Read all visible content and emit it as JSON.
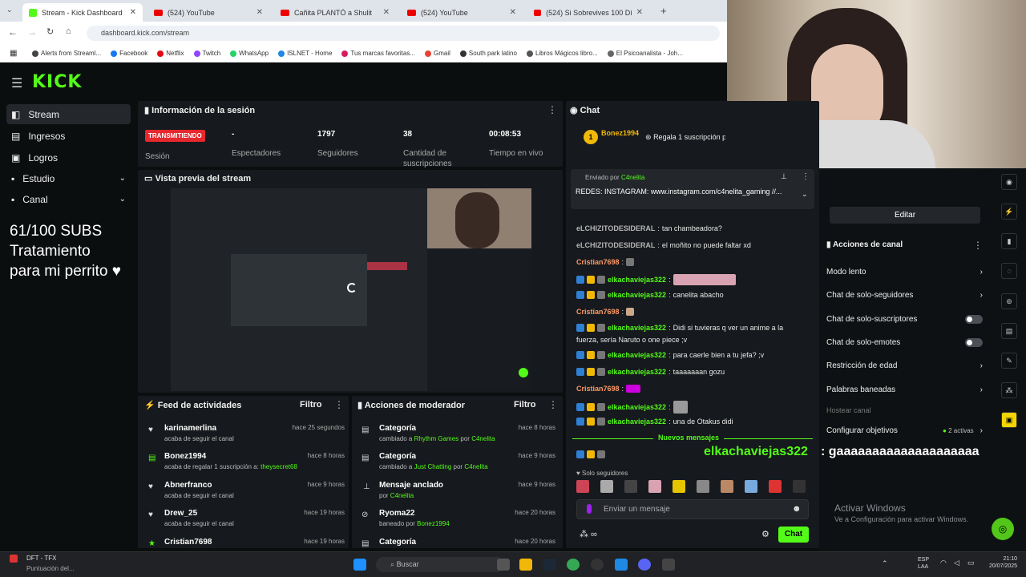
{
  "browser": {
    "tabs": [
      {
        "label": "Stream - Kick Dashboard"
      },
      {
        "label": "(524) YouTube"
      },
      {
        "label": "Cañita PLANTÓ a Shulit"
      },
      {
        "label": "(524) YouTube"
      },
      {
        "label": "(524) Si Sobrevives 100 Días At"
      }
    ],
    "url": "dashboard.kick.com/stream",
    "bookmarks": [
      "Alerts from Streaml...",
      "Facebook",
      "Netflix",
      "Twitch",
      "WhatsApp",
      "ISLNET - Home",
      "Tus marcas favoritas...",
      "Gmail",
      "South park latino",
      "Libros Mágicos libro...",
      "El Psicoanalista - Joh..."
    ]
  },
  "kick": {
    "logo": "KICK"
  },
  "sidebar": {
    "items": [
      {
        "label": "Stream"
      },
      {
        "label": "Ingresos"
      },
      {
        "label": "Logros"
      },
      {
        "label": "Estudio"
      },
      {
        "label": "Canal"
      }
    ]
  },
  "overlay": {
    "line1": "61/100 SUBS",
    "line2": "Tratamiento",
    "line3": "para mi perrito ♥"
  },
  "session": {
    "title": "Información de la sesión",
    "status": "TRANSMITIENDO",
    "status_label": "Sesión",
    "viewers": "-",
    "viewers_label": "Espectadores",
    "followers": "1797",
    "followers_label": "Seguidores",
    "subs": "38",
    "subs_label": "Cantidad de suscripciones",
    "uptime": "00:08:53",
    "uptime_label": "Tiempo en vivo"
  },
  "preview": {
    "title": "Vista previa del stream"
  },
  "activity": {
    "title": "Feed de actividades",
    "filter": "Filtro",
    "items": [
      {
        "name": "karinamerlina",
        "sub": "acaba de seguir el canal",
        "time": "hace 25 segundos"
      },
      {
        "name": "Bonez1994",
        "sub": "acaba de regalar 1 suscripción a:",
        "sub2": "theysecret68",
        "time": "hace 8 horas"
      },
      {
        "name": "Abnerfranco",
        "sub": "acaba de seguir el canal",
        "time": "hace 9 horas"
      },
      {
        "name": "Drew_25",
        "sub": "acaba de seguir el canal",
        "time": "hace 19 horas"
      },
      {
        "name": "Cristian7698",
        "sub": "",
        "time": "hace 19 horas"
      }
    ]
  },
  "modactions": {
    "title": "Acciones de moderador",
    "filter": "Filtro",
    "items": [
      {
        "name": "Categoría",
        "sub": "cambiado a",
        "hl": "Rhythm Games",
        "sub2": "por",
        "by": "C4nelita",
        "time": "hace 8 horas"
      },
      {
        "name": "Categoría",
        "sub": "cambiado a",
        "hl": "Just Chatting",
        "sub2": "por",
        "by": "C4nelita",
        "time": "hace 9 horas"
      },
      {
        "name": "Mensaje anclado",
        "sub": "por",
        "hl": "C4nelita",
        "sub2": "",
        "by": "",
        "time": "hace 9 horas"
      },
      {
        "name": "Ryoma22",
        "sub": "baneado por",
        "hl": "Bonez1994",
        "sub2": "",
        "by": "",
        "time": "hace 20 horas"
      },
      {
        "name": "Categoría",
        "sub": "",
        "hl": "",
        "sub2": "",
        "by": "",
        "time": "hace 20 horas"
      }
    ]
  },
  "chat": {
    "title": "Chat",
    "gift_user": "Bonez1994",
    "gift_count": "1",
    "gift_text": "Regala 1 suscripción p",
    "pinned_by_label": "Enviado por",
    "pinned_by": "C4nelita",
    "pinned_text": "REDES: INSTAGRAM: www.instagram.com/c4nelita_gaming //...",
    "messages": [
      {
        "user": "eLCHIZITODESIDERAL",
        "text": "tan chambeadora?"
      },
      {
        "user": "eLCHIZITODESIDERAL",
        "text": "el moñito no puede faltar xd"
      },
      {
        "user": "Cristian7698",
        "text": ""
      },
      {
        "user": "elkachaviejas322",
        "text": ""
      },
      {
        "user": "elkachaviejas322",
        "text": "canelita abacho"
      },
      {
        "user": "Cristian7698",
        "text": ""
      },
      {
        "user": "elkachaviejas322",
        "text": "Didi si tuvieras q ver un anime a la"
      },
      {
        "user": "",
        "text": "fuerza, sería Naruto o one piece ;v"
      },
      {
        "user": "elkachaviejas322",
        "text": "para caerle bien a tu jefa? ;v"
      },
      {
        "user": "elkachaviejas322",
        "text": "taaaaaaan gozu"
      },
      {
        "user": "Cristian7698",
        "text": ""
      },
      {
        "user": "elkachaviejas322",
        "text": ""
      },
      {
        "user": "elkachaviejas322",
        "text": "una de Otakus didi"
      }
    ],
    "new_messages": "Nuevos mensajes",
    "last_user": "elkachaviejas322",
    "big_msg": ": gaaaaaaaaaaaaaaaaaaaa",
    "followers_only": "Solo seguidores",
    "input_placeholder": "Enviar un mensaje",
    "send": "Chat"
  },
  "channel": {
    "edit": "Editar",
    "title": "Acciones de canal",
    "items": [
      "Modo lento",
      "Chat de solo-seguidores",
      "Chat de solo-suscriptores",
      "Chat de solo-emotes",
      "Restricción de edad",
      "Palabras baneadas",
      "Hostear canal",
      "Configurar objetivos"
    ],
    "goals_active": "2 activas"
  },
  "windows": {
    "activate": "Activar Windows",
    "activate_sub": "Ve a Configuración para activar Windows."
  },
  "taskbar": {
    "app1": "DFT - TFX",
    "app1_sub": "Puntuación del...",
    "search": "Buscar",
    "lang1": "ESP",
    "lang2": "LAA",
    "time": "21:10",
    "date": "20/07/2025"
  },
  "colors": {
    "accent": "#53fc18",
    "live": "#e5282e",
    "bg": "#0b0e0f",
    "panel": "#16191d"
  }
}
